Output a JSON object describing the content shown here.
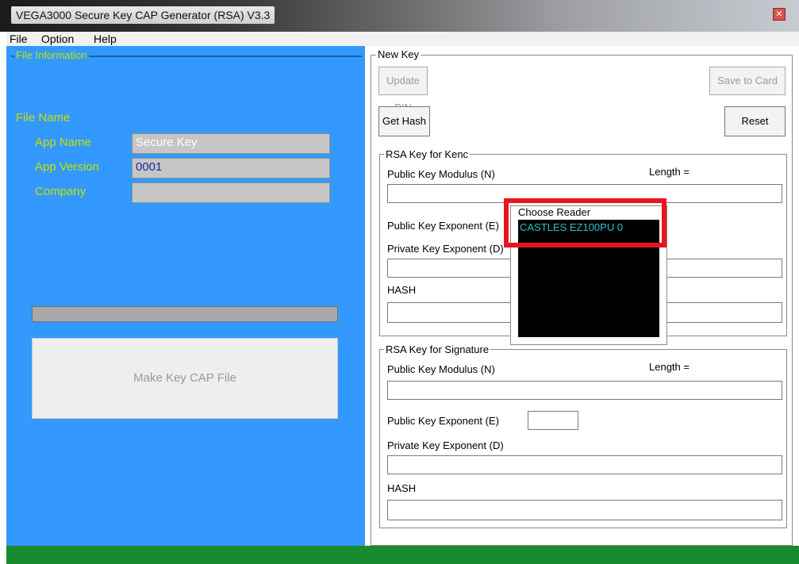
{
  "window": {
    "title": "VEGA3000 Secure Key CAP Generator (RSA) V3.3",
    "close_icon": "close-icon"
  },
  "menu": [
    {
      "label": "File"
    },
    {
      "label": "Option"
    },
    {
      "label": "Help"
    }
  ],
  "file_info": {
    "legend": "File Information",
    "file_name_label": "File Name",
    "app_name_label": "App Name",
    "app_name_value": "Secure Key",
    "app_version_label": "App Version",
    "app_version_value": "0001",
    "company_label": "Company",
    "company_value": "",
    "make_button": "Make Key CAP File"
  },
  "new_key": {
    "legend": "New Key",
    "update_pin": "Update PIN",
    "save_to_card": "Save to Card",
    "get_hash": "Get Hash",
    "reset": "Reset"
  },
  "rsa_kenc": {
    "legend": "RSA Key for Kenc",
    "modulus_label": "Public Key Modulus (N)",
    "length_label": "Length =",
    "exponent_label": "Public Key Exponent (E)",
    "private_label": "Private Key Exponent (D)",
    "hash_label": "HASH"
  },
  "rsa_sig": {
    "legend": "RSA Key for Signature",
    "modulus_label": "Public Key Modulus (N)",
    "length_label": "Length =",
    "exponent_label": "Public Key Exponent (E)",
    "private_label": "Private Key Exponent (D)",
    "hash_label": "HASH"
  },
  "reader_popup": {
    "legend": "Choose Reader",
    "items": [
      "CASTLES EZ100PU 0"
    ]
  },
  "colors": {
    "left_pane": "#3399ff",
    "label_text": "#c4e000",
    "status_bar": "#1a8a2e",
    "highlight": "#e8141e"
  }
}
